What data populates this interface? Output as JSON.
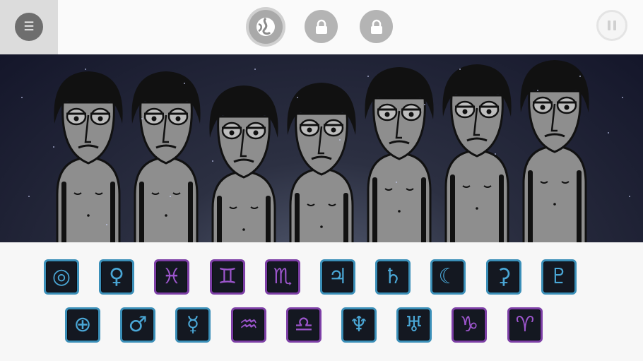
{
  "topbar": {
    "menu_glyph": "☰",
    "pause_label": "pause",
    "stage_icon": "swirl-icon",
    "locked_icon": "lock-icon"
  },
  "colors": {
    "blue_border": "#3b8fb8",
    "purple_border": "#7d3fa6",
    "stage_dark": "#14162a"
  },
  "performers": {
    "count": 7
  },
  "sounds": {
    "row1": [
      {
        "glyph": "◎",
        "name": "sun-icon",
        "tint": "blue"
      },
      {
        "glyph": "♀",
        "name": "venus-icon",
        "tint": "blue"
      },
      {
        "glyph": "♓",
        "name": "pisces-icon",
        "tint": "purple"
      },
      {
        "glyph": "♊",
        "name": "gemini-icon",
        "tint": "purple"
      },
      {
        "glyph": "♏",
        "name": "scorpio-icon",
        "tint": "purple"
      },
      {
        "glyph": "♃",
        "name": "jupiter-icon",
        "tint": "blue"
      },
      {
        "glyph": "♄",
        "name": "saturn-icon",
        "tint": "blue"
      },
      {
        "glyph": "☾",
        "name": "moon-icon",
        "tint": "blue"
      },
      {
        "glyph": "⚳",
        "name": "ceres-icon",
        "tint": "blue"
      },
      {
        "glyph": "♇",
        "name": "pluto-icon",
        "tint": "blue"
      }
    ],
    "row2": [
      {
        "glyph": "⊕",
        "name": "earth-icon",
        "tint": "blue"
      },
      {
        "glyph": "♂",
        "name": "mars-icon",
        "tint": "blue"
      },
      {
        "glyph": "☿",
        "name": "mercury-icon",
        "tint": "blue"
      },
      {
        "glyph": "♒",
        "name": "aquarius-icon",
        "tint": "purple"
      },
      {
        "glyph": "♎",
        "name": "libra-icon",
        "tint": "purple"
      },
      {
        "glyph": "♆",
        "name": "neptune-icon",
        "tint": "blue"
      },
      {
        "glyph": "♅",
        "name": "uranus-icon",
        "tint": "blue"
      },
      {
        "glyph": "♑",
        "name": "capricorn-icon",
        "tint": "purple"
      },
      {
        "glyph": "♈",
        "name": "aries-icon",
        "tint": "purple"
      }
    ]
  }
}
